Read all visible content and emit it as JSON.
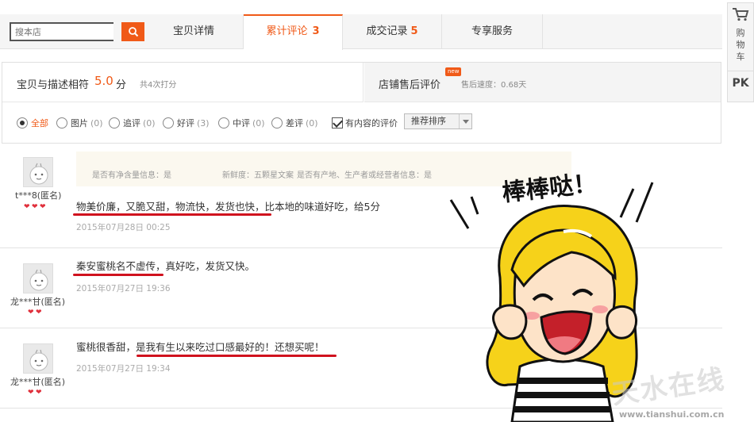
{
  "search": {
    "placeholder": "搜本店"
  },
  "tabs": {
    "detail": "宝贝详情",
    "reviews_label": "累计评论",
    "reviews_count": "3",
    "sales_label": "成交记录",
    "sales_count": "5",
    "service": "专享服务"
  },
  "sidebar": {
    "cart_label": "购物车",
    "pk_label": "PK"
  },
  "summary": {
    "match_label": "宝贝与描述相符",
    "match_score": "5.0",
    "match_unit": "分",
    "match_count": "共4次打分",
    "aftersale_label": "店铺售后评价",
    "new_badge": "new",
    "speed_label": "售后速度：0.68天"
  },
  "filters": {
    "all": "全部",
    "pic": "图片",
    "pic_n": "(0)",
    "add": "追评",
    "add_n": "(0)",
    "good": "好评",
    "good_n": "(3)",
    "mid": "中评",
    "mid_n": "(0)",
    "bad": "差评",
    "bad_n": "(0)",
    "content_only": "有内容的评价",
    "sort": "推荐排序"
  },
  "reviews": [
    {
      "user": "t***8(匿名)",
      "attrs": [
        "是否有净含量信息：是",
        "新鲜度：五颗星文案",
        "是否有产地、生产者或经营者信息：是"
      ],
      "content": "物美价廉，又脆又甜，物流快，发货也快，比本地的味道好吃，给5分",
      "date": "2015年07月28日 00:25"
    },
    {
      "user": "龙***甘(匿名)",
      "content": "秦安蜜桃名不虚传，真好吃，发货又快。",
      "date": "2015年07月27日 19:36"
    },
    {
      "user": "龙***甘(匿名)",
      "content": "蜜桃很香甜，是我有生以来吃过口感最好的！还想买呢！",
      "date": "2015年07月27日 19:34"
    }
  ],
  "overlay": {
    "exclaim": "棒棒哒！",
    "watermark_cn": "天水在线",
    "watermark_url": "www.tianshui.com.cn"
  },
  "colors": {
    "accent": "#f05a18",
    "underline": "#d0121e",
    "hair": "#f6d21a"
  }
}
